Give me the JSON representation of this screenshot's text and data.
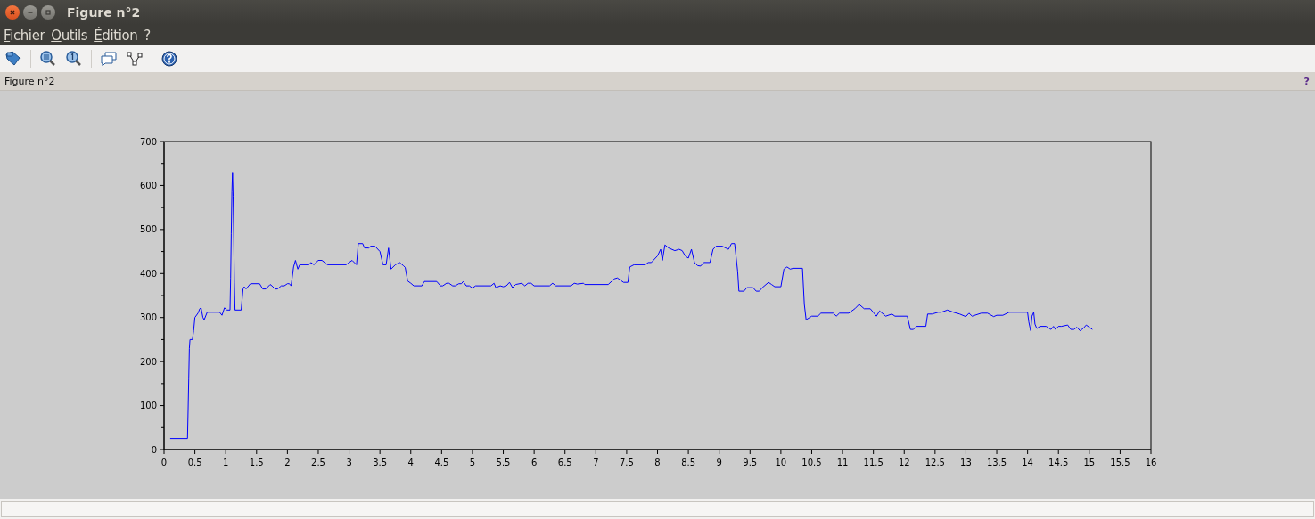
{
  "window": {
    "title": "Figure n°2"
  },
  "menu": [
    {
      "label": "Fichier"
    },
    {
      "label": "Outils"
    },
    {
      "label": "Édition"
    },
    {
      "label": "?"
    }
  ],
  "dock": {
    "title": "Figure n°2",
    "help": "?"
  },
  "chart_data": {
    "type": "line",
    "x": [
      0.1,
      0.38,
      0.39,
      0.4,
      0.41,
      0.42,
      0.46,
      0.48,
      0.5,
      0.55,
      0.58,
      0.6,
      0.63,
      0.65,
      0.7,
      0.9,
      0.94,
      0.98,
      1.02,
      1.07,
      1.08,
      1.09,
      1.1,
      1.11,
      1.12,
      1.13,
      1.14,
      1.15,
      1.25,
      1.28,
      1.3,
      1.33,
      1.4,
      1.55,
      1.6,
      1.65,
      1.72,
      1.75,
      1.8,
      1.84,
      1.9,
      1.95,
      2.0,
      2.03,
      2.06,
      2.1,
      2.13,
      2.17,
      2.2,
      2.35,
      2.38,
      2.43,
      2.5,
      2.56,
      2.65,
      2.95,
      3.05,
      3.12,
      3.15,
      3.22,
      3.25,
      3.32,
      3.35,
      3.42,
      3.5,
      3.55,
      3.6,
      3.64,
      3.68,
      3.75,
      3.82,
      3.88,
      3.91,
      3.95,
      4.0,
      4.05,
      4.18,
      4.22,
      4.42,
      4.48,
      4.52,
      4.58,
      4.62,
      4.68,
      4.72,
      4.78,
      4.82,
      4.85,
      4.9,
      4.95,
      5.0,
      5.05,
      5.3,
      5.35,
      5.38,
      5.45,
      5.5,
      5.55,
      5.6,
      5.65,
      5.7,
      5.8,
      5.85,
      5.9,
      5.95,
      6.0,
      6.25,
      6.3,
      6.35,
      6.6,
      6.65,
      6.7,
      6.8,
      6.82,
      7.2,
      7.3,
      7.35,
      7.45,
      7.52,
      7.55,
      7.62,
      7.8,
      7.85,
      7.9,
      8.0,
      8.05,
      8.08,
      8.12,
      8.18,
      8.28,
      8.35,
      8.4,
      8.45,
      8.5,
      8.55,
      8.6,
      8.65,
      8.7,
      8.75,
      8.85,
      8.9,
      8.95,
      9.05,
      9.15,
      9.2,
      9.25,
      9.3,
      9.32,
      9.4,
      9.45,
      9.55,
      9.6,
      9.65,
      9.7,
      9.8,
      9.85,
      9.9,
      10.0,
      10.05,
      10.1,
      10.15,
      10.2,
      10.35,
      10.38,
      10.41,
      10.5,
      10.6,
      10.65,
      10.85,
      10.9,
      10.95,
      11.1,
      11.2,
      11.27,
      11.35,
      11.45,
      11.55,
      11.6,
      11.7,
      11.8,
      11.85,
      12.05,
      12.1,
      12.15,
      12.2,
      12.35,
      12.38,
      12.45,
      12.55,
      12.6,
      12.7,
      12.8,
      12.9,
      13.0,
      13.05,
      13.1,
      13.25,
      13.35,
      13.45,
      13.5,
      13.6,
      13.7,
      14.0,
      14.02,
      14.05,
      14.07,
      14.1,
      14.12,
      14.15,
      14.2,
      14.3,
      14.38,
      14.42,
      14.45,
      14.5,
      14.55,
      14.65,
      14.7,
      14.75,
      14.8,
      14.85,
      14.9,
      14.95,
      15.0,
      15.05
    ],
    "series": [
      {
        "color": "#0000ff",
        "values": [
          25,
          25,
          90,
          160,
          230,
          250,
          250,
          270,
          300,
          310,
          320,
          322,
          300,
          295,
          312,
          312,
          305,
          322,
          317,
          317,
          390,
          490,
          585,
          630,
          575,
          480,
          380,
          317,
          317,
          365,
          370,
          365,
          377,
          377,
          365,
          365,
          375,
          372,
          365,
          365,
          372,
          372,
          377,
          377,
          372,
          415,
          430,
          410,
          420,
          420,
          425,
          420,
          430,
          430,
          420,
          420,
          430,
          420,
          468,
          468,
          458,
          458,
          462,
          462,
          450,
          420,
          420,
          458,
          410,
          420,
          425,
          418,
          414,
          383,
          378,
          372,
          372,
          382,
          382,
          372,
          372,
          378,
          378,
          372,
          372,
          377,
          377,
          382,
          372,
          372,
          367,
          372,
          372,
          378,
          368,
          372,
          370,
          372,
          380,
          368,
          375,
          378,
          372,
          378,
          378,
          372,
          372,
          378,
          372,
          372,
          378,
          376,
          378,
          375,
          375,
          388,
          390,
          380,
          380,
          415,
          420,
          420,
          425,
          425,
          440,
          455,
          430,
          465,
          458,
          452,
          455,
          452,
          440,
          435,
          455,
          425,
          418,
          417,
          425,
          425,
          455,
          462,
          462,
          455,
          468,
          468,
          405,
          360,
          360,
          368,
          368,
          360,
          360,
          368,
          380,
          375,
          370,
          370,
          410,
          415,
          410,
          412,
          412,
          330,
          295,
          303,
          303,
          310,
          310,
          303,
          310,
          310,
          320,
          330,
          320,
          320,
          303,
          315,
          303,
          308,
          303,
          303,
          273,
          273,
          280,
          280,
          308,
          308,
          312,
          312,
          317,
          312,
          308,
          302,
          310,
          303,
          310,
          310,
          302,
          305,
          305,
          312,
          312,
          290,
          270,
          303,
          312,
          285,
          275,
          280,
          280,
          273,
          280,
          273,
          280,
          280,
          283,
          273,
          273,
          278,
          270,
          275,
          283,
          278,
          273
        ]
      }
    ],
    "xlim": [
      0,
      16
    ],
    "ylim": [
      0,
      700
    ],
    "xticks": [
      0,
      0.5,
      1,
      1.5,
      2,
      2.5,
      3,
      3.5,
      4,
      4.5,
      5,
      5.5,
      6,
      6.5,
      7,
      7.5,
      8,
      8.5,
      9,
      9.5,
      10,
      10.5,
      11,
      11.5,
      12,
      12.5,
      13,
      13.5,
      14,
      14.5,
      15,
      15.5,
      16
    ],
    "yticks": [
      0,
      100,
      200,
      300,
      400,
      500,
      600,
      700
    ]
  }
}
